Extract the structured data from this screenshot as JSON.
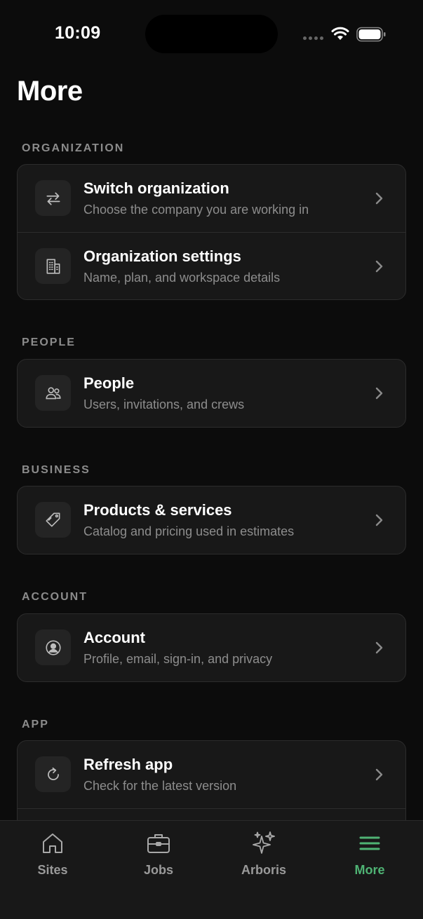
{
  "status_bar": {
    "time": "10:09"
  },
  "page": {
    "title": "More"
  },
  "sections": [
    {
      "label": "ORGANIZATION",
      "items": [
        {
          "title": "Switch organization",
          "subtitle": "Choose the company you are working in",
          "icon": "switch-arrows-icon"
        },
        {
          "title": "Organization settings",
          "subtitle": "Name, plan, and workspace details",
          "icon": "building-icon"
        }
      ]
    },
    {
      "label": "PEOPLE",
      "items": [
        {
          "title": "People",
          "subtitle": "Users, invitations, and crews",
          "icon": "users-icon"
        }
      ]
    },
    {
      "label": "BUSINESS",
      "items": [
        {
          "title": "Products & services",
          "subtitle": "Catalog and pricing used in estimates",
          "icon": "tag-icon"
        }
      ]
    },
    {
      "label": "ACCOUNT",
      "items": [
        {
          "title": "Account",
          "subtitle": "Profile, email, sign-in, and privacy",
          "icon": "user-circle-icon"
        }
      ]
    },
    {
      "label": "APP",
      "items": [
        {
          "title": "Refresh app",
          "subtitle": "Check for the latest version",
          "icon": "refresh-icon"
        }
      ]
    }
  ],
  "tab_bar": {
    "tabs": [
      {
        "label": "Sites",
        "icon": "home-icon",
        "active": false
      },
      {
        "label": "Jobs",
        "icon": "briefcase-icon",
        "active": false
      },
      {
        "label": "Arboris",
        "icon": "sparkles-icon",
        "active": false
      },
      {
        "label": "More",
        "icon": "menu-icon",
        "active": true
      }
    ]
  },
  "colors": {
    "background": "#0c0c0c",
    "card": "#181818",
    "accent": "#4fb374",
    "muted_text": "#8d8d8d"
  }
}
